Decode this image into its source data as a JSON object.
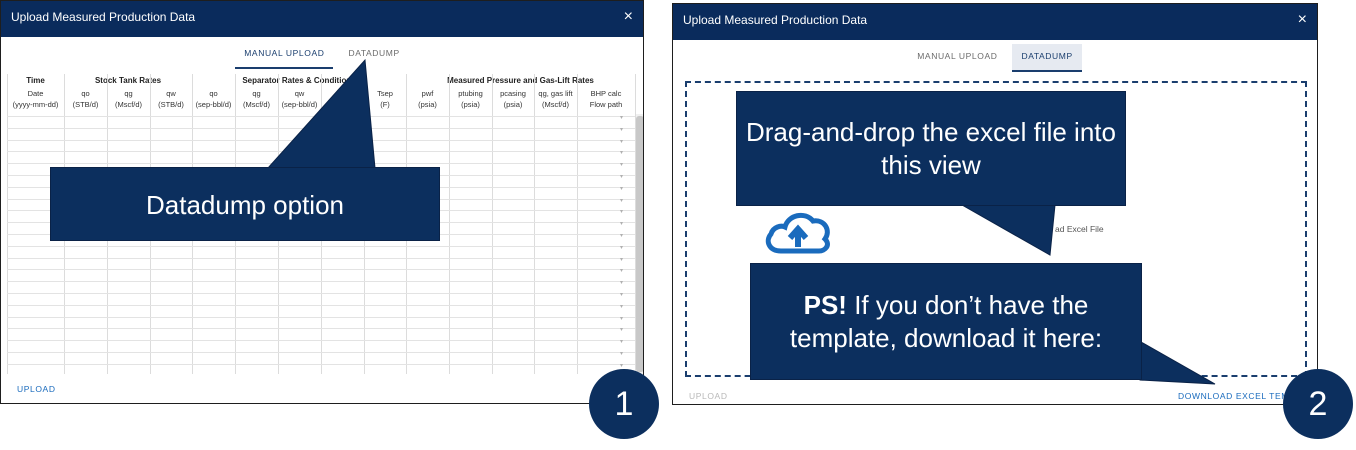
{
  "dialog1": {
    "title": "Upload Measured Production Data",
    "close": "×",
    "tabs": [
      "MANUAL UPLOAD",
      "DATADUMP"
    ],
    "groups": [
      "Time",
      "Stock Tank Rates",
      "Separator Rates & Conditions",
      "Measured Pressure and Gas-Lift Rates"
    ],
    "columns": [
      {
        "h": "Date",
        "u": "(yyyy-mm-dd)"
      },
      {
        "h": "qo",
        "u": "(STB/d)"
      },
      {
        "h": "qg",
        "u": "(Mscf/d)"
      },
      {
        "h": "qw",
        "u": "(STB/d)"
      },
      {
        "h": "qo",
        "u": "(sep-bbl/d)"
      },
      {
        "h": "qg",
        "u": "(Mscf/d)"
      },
      {
        "h": "qw",
        "u": "(sep-bbl/d)"
      },
      {
        "h": "p",
        "u": ""
      },
      {
        "h": "Tsep",
        "u": "(F)"
      },
      {
        "h": "pwf",
        "u": "(psia)"
      },
      {
        "h": "ptubing",
        "u": "(psia)"
      },
      {
        "h": "pcasing",
        "u": "(psia)"
      },
      {
        "h": "qg, gas lift",
        "u": "(Mscf/d)"
      },
      {
        "h": "BHP calc",
        "u": "Flow path"
      }
    ],
    "upload": "UPLOAD",
    "callout": "Datadump option",
    "badge": "1"
  },
  "dialog2": {
    "title": "Upload Measured Production Data",
    "close": "×",
    "tabs": [
      "MANUAL UPLOAD",
      "DATADUMP"
    ],
    "drop_label": "ad Excel File",
    "upload": "UPLOAD",
    "download": "DOWNLOAD EXCEL TEMP",
    "callout_drag": "Drag-and-drop the excel file into this view",
    "callout_ps_bold": "PS!",
    "callout_ps": " If you don’t have the template, download it here:",
    "badge": "2"
  },
  "colors": {
    "navy": "#0c2f5e",
    "link": "#1a6bbd",
    "titlebar": "#0a2b5c"
  },
  "icons": {
    "upload_cloud": "cloud-upload-icon",
    "close": "close-icon"
  }
}
